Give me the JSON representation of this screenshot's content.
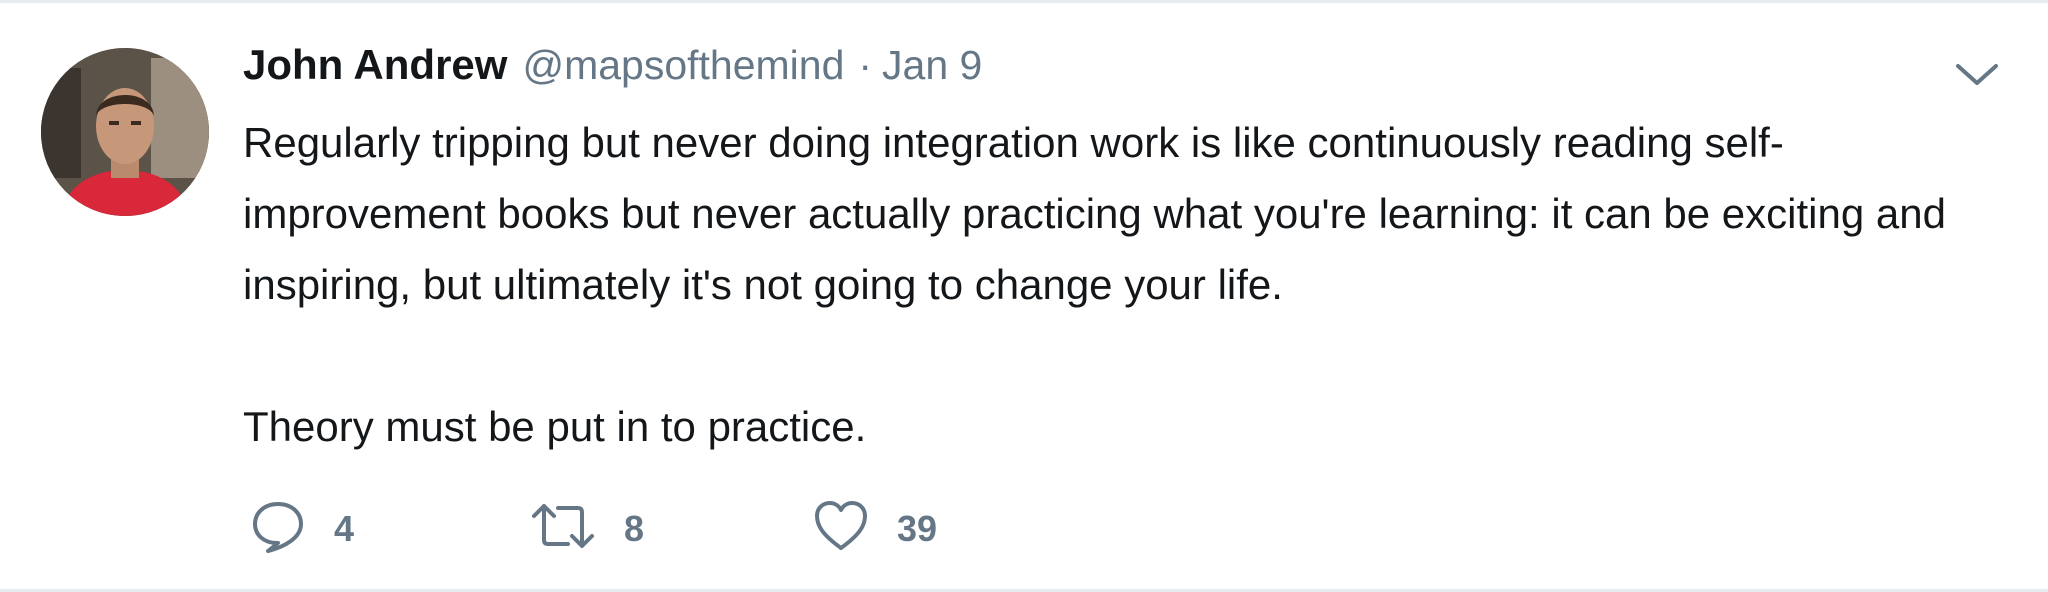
{
  "tweet": {
    "author_name": "John Andrew",
    "handle": "@mapsofthemind",
    "separator": "·",
    "date": "Jan 9",
    "text": "Regularly tripping but never doing integration work is like continuously reading self-improvement books but never actually practicing what you're learning: it can be exciting and inspiring, but ultimately it's not going to change your life.\n\nTheory must be put in to practice."
  },
  "actions": {
    "reply_count": "4",
    "retweet_count": "8",
    "like_count": "39"
  },
  "icons": {
    "reply": "speech-bubble-icon",
    "retweet": "retweet-arrows-icon",
    "like": "heart-icon",
    "menu": "chevron-down-icon"
  },
  "colors": {
    "text": "#14171a",
    "secondary": "#657786",
    "divider": "#e6ecf0"
  }
}
